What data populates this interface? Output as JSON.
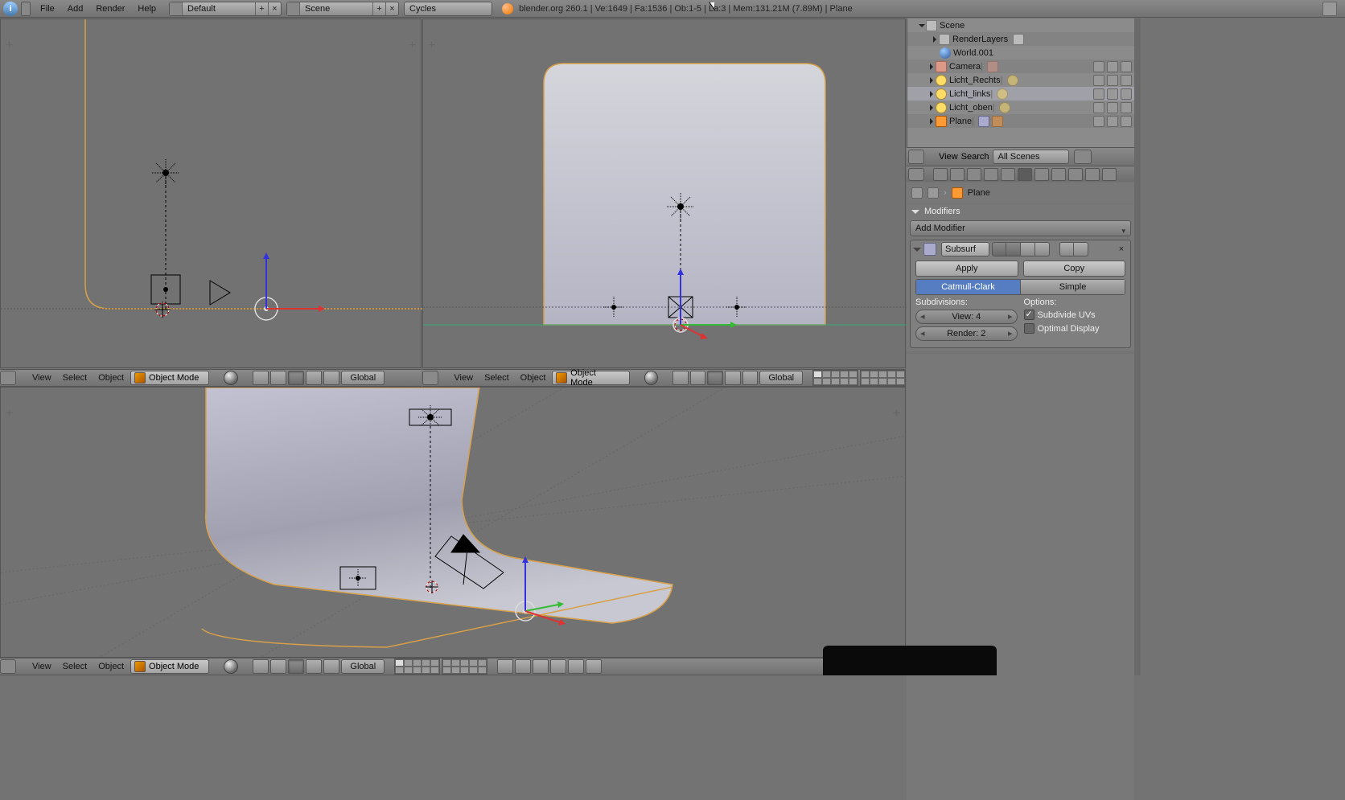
{
  "menu": {
    "file": "File",
    "add": "Add",
    "render": "Render",
    "help": "Help"
  },
  "layout_name": "Default",
  "scene_name": "Scene",
  "engine": "Cycles",
  "stats": "blender.org  260.1 | Ve:1649 | Fa:1536 | Ob:1-5 | La:3 | Mem:131.21M (7.89M) | Plane",
  "vp": {
    "view": "View",
    "select": "Select",
    "object": "Object",
    "mode": "Object Mode",
    "orient": "Global"
  },
  "outliner": {
    "scene": "Scene",
    "renderlayers": "RenderLayers",
    "world": "World.001",
    "items": [
      {
        "name": "Camera",
        "kind": "cam"
      },
      {
        "name": "Licht_Rechts",
        "kind": "lamp"
      },
      {
        "name": "Licht_links",
        "kind": "lamp",
        "sel": true
      },
      {
        "name": "Licht_oben",
        "kind": "lamp"
      },
      {
        "name": "Plane",
        "kind": "mesh"
      }
    ],
    "footer_view": "View",
    "footer_search": "Search",
    "footer_filter": "All Scenes"
  },
  "breadcrumb_obj": "Plane",
  "mod": {
    "panel_title": "Modifiers",
    "add_label": "Add Modifier",
    "name": "Subsurf",
    "apply": "Apply",
    "copy": "Copy",
    "catmull": "Catmull-Clark",
    "simple": "Simple",
    "subdiv_label": "Subdivisions:",
    "view_label": "View: 4",
    "render_label": "Render: 2",
    "options_label": "Options:",
    "subdiv_uv": "Subdivide UVs",
    "optimal": "Optimal Display"
  }
}
